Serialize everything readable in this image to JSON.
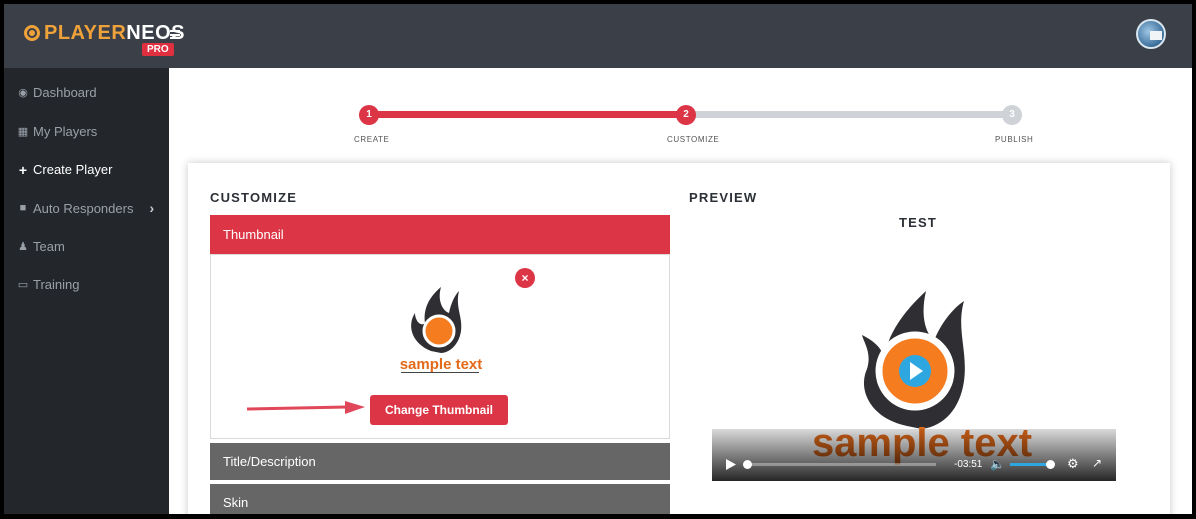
{
  "app": {
    "brand_part1": "PLAYER",
    "brand_part2": "NEOS",
    "edition": "PRO"
  },
  "sidebar": {
    "items": [
      {
        "label": "Dashboard",
        "icon": "dashboard-icon"
      },
      {
        "label": "My Players",
        "icon": "grid-icon"
      },
      {
        "label": "Create Player",
        "icon": "plus-icon"
      },
      {
        "label": "Auto Responders",
        "icon": "folder-icon"
      },
      {
        "label": "Team",
        "icon": "team-icon"
      },
      {
        "label": "Training",
        "icon": "monitor-icon"
      }
    ]
  },
  "stepper": {
    "steps": [
      {
        "number": "1",
        "label": "CREATE"
      },
      {
        "number": "2",
        "label": "CUSTOMIZE"
      },
      {
        "number": "3",
        "label": "PUBLISH"
      }
    ],
    "current_step": 2
  },
  "customize": {
    "title": "CUSTOMIZE",
    "sections": [
      {
        "label": "Thumbnail",
        "expanded": true
      },
      {
        "label": "Title/Description",
        "expanded": false
      },
      {
        "label": "Skin",
        "expanded": false
      }
    ],
    "thumbnail": {
      "remove_label": "×",
      "change_button": "Change Thumbnail",
      "image_text": "sample text"
    }
  },
  "preview": {
    "title": "PREVIEW",
    "player_name": "TEST",
    "time_remaining": "-03:51",
    "image_text": "sample text"
  },
  "colors": {
    "accent": "#dc3545",
    "topbar": "#3a3f48",
    "sidebar": "#23262b"
  }
}
